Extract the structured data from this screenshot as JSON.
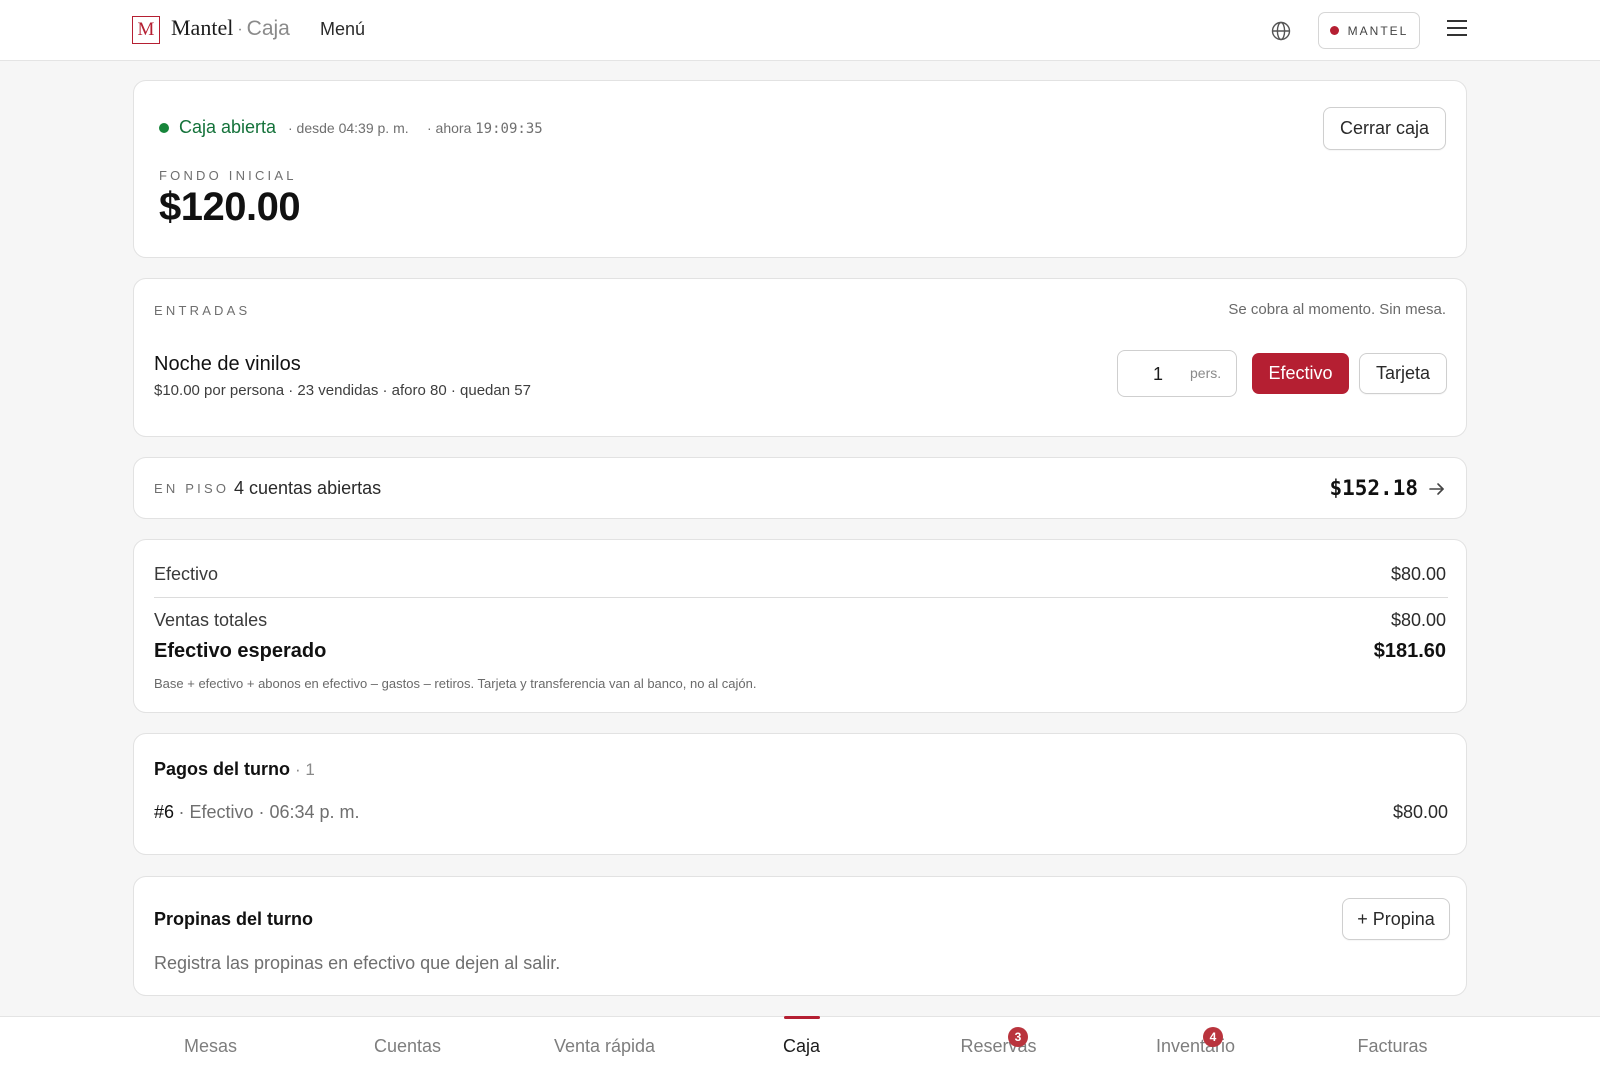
{
  "header": {
    "logo_letter": "M",
    "brand": "Mantel",
    "brand_separator": "·",
    "section": "Caja",
    "menu_label": "Menú",
    "org_label": "MANTEL"
  },
  "register": {
    "status": "Caja abierta",
    "since": "· desde 04:39 p. m.",
    "now_prefix": "· ahora",
    "now_time": "19:09:35",
    "close_button": "Cerrar caja",
    "fund_label": "FONDO INICIAL",
    "fund_amount": "$120.00"
  },
  "entries": {
    "label": "ENTRADAS",
    "note": "Se cobra al momento. Sin mesa.",
    "event_title": "Noche de vinilos",
    "event_details": "$10.00 por persona · 23 vendidas · aforo 80 · quedan 57",
    "quantity": "1",
    "quantity_unit": "pers.",
    "cash_button": "Efectivo",
    "card_button": "Tarjeta"
  },
  "floor": {
    "label": "EN PISO",
    "open_accounts": "4 cuentas abiertas",
    "total": "$152.18"
  },
  "totals": {
    "cash_label": "Efectivo",
    "cash_value": "$80.00",
    "sales_label": "Ventas totales",
    "sales_value": "$80.00",
    "expected_label": "Efectivo esperado",
    "expected_value": "$181.60",
    "footnote": "Base + efectivo + abonos en efectivo – gastos – retiros. Tarjeta y transferencia van al banco, no al cajón."
  },
  "payments": {
    "title": "Pagos del turno",
    "count": "· 1",
    "items": [
      {
        "id": "#6",
        "detail": "· Efectivo · 06:34 p. m.",
        "amount": "$80.00"
      }
    ]
  },
  "tips": {
    "title": "Propinas del turno",
    "add_button": "+ Propina",
    "hint": "Registra las propinas en efectivo que dejen al salir."
  },
  "bottom_nav": [
    {
      "label": "Mesas"
    },
    {
      "label": "Cuentas"
    },
    {
      "label": "Venta rápida"
    },
    {
      "label": "Caja",
      "active": true
    },
    {
      "label": "Reservas",
      "badge": "3"
    },
    {
      "label": "Inventario",
      "badge": "4"
    },
    {
      "label": "Facturas"
    }
  ],
  "colors": {
    "accent": "#b51f32",
    "status_open": "#17853a",
    "background": "#f6f6f6"
  },
  "icons": [
    "globe-icon",
    "menu-icon",
    "arrow-right-icon"
  ]
}
